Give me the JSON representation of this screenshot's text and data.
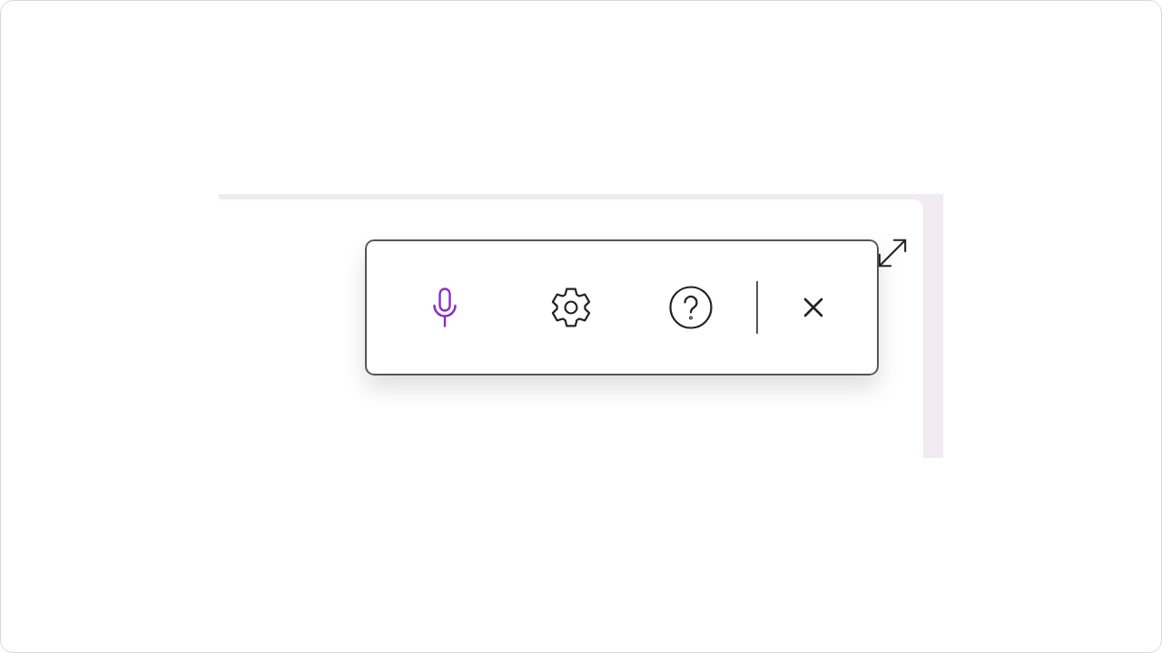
{
  "toolbar": {
    "items": [
      {
        "kind": "microphone",
        "on": true
      },
      {
        "kind": "settings",
        "on": false
      },
      {
        "kind": "help",
        "on": false
      },
      {
        "kind": "separator"
      },
      {
        "kind": "close",
        "on": false
      }
    ]
  }
}
